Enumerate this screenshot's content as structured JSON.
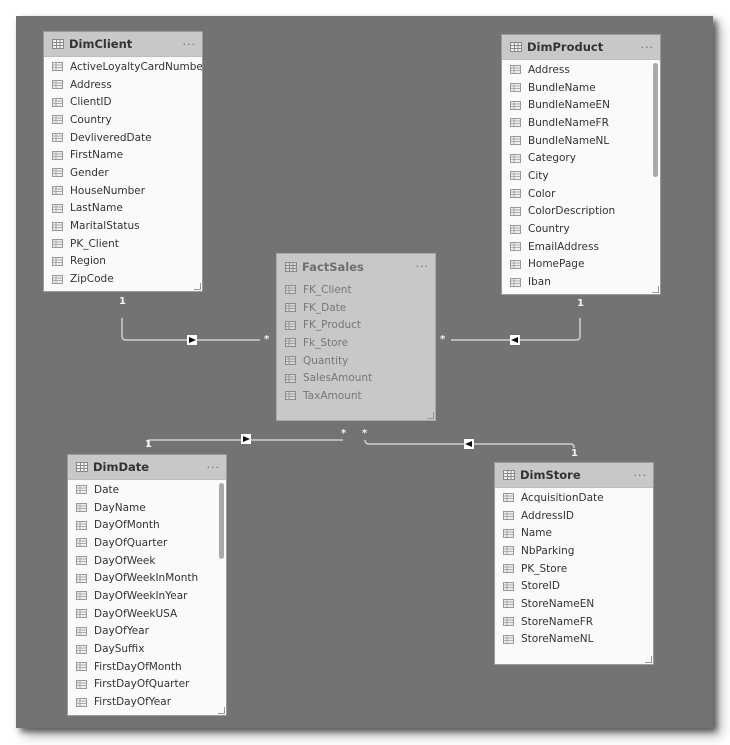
{
  "diagram": {
    "tables": {
      "dimclient": {
        "name": "DimClient",
        "more": "···",
        "columns": [
          "ActiveLoyaltyCardNumber",
          "Address",
          "ClientID",
          "Country",
          "DevliveredDate",
          "FirstName",
          "Gender",
          "HouseNumber",
          "LastName",
          "MaritalStatus",
          "PK_Client",
          "Region",
          "ZipCode"
        ]
      },
      "dimproduct": {
        "name": "DimProduct",
        "more": "···",
        "columns": [
          "Address",
          "BundleName",
          "BundleNameEN",
          "BundleNameFR",
          "BundleNameNL",
          "Category",
          "City",
          "Color",
          "ColorDescription",
          "Country",
          "EmailAddress",
          "HomePage",
          "Iban"
        ]
      },
      "factsales": {
        "name": "FactSales",
        "more": "···",
        "columns": [
          "FK_Client",
          "FK_Date",
          "FK_Product",
          "Fk_Store",
          "Quantity",
          "SalesAmount",
          "TaxAmount"
        ]
      },
      "dimdate": {
        "name": "DimDate",
        "more": "···",
        "columns": [
          "Date",
          "DayName",
          "DayOfMonth",
          "DayOfQuarter",
          "DayOfWeek",
          "DayOfWeekInMonth",
          "DayOfWeekInYear",
          "DayOfWeekUSA",
          "DayOfYear",
          "DaySuffix",
          "FirstDayOfMonth",
          "FirstDayOfQuarter",
          "FirstDayOfYear"
        ]
      },
      "dimstore": {
        "name": "DimStore",
        "more": "···",
        "columns": [
          "AcquisitionDate",
          "AddressID",
          "Name",
          "NbParking",
          "PK_Store",
          "StoreID",
          "StoreNameEN",
          "StoreNameFR",
          "StoreNameNL"
        ]
      }
    },
    "relationships": [
      {
        "from": "DimClient",
        "to": "FactSales",
        "one": "1",
        "many": "*",
        "direction": "single"
      },
      {
        "from": "DimProduct",
        "to": "FactSales",
        "one": "1",
        "many": "*",
        "direction": "single"
      },
      {
        "from": "DimDate",
        "to": "FactSales",
        "one": "1",
        "many": "*",
        "direction": "single"
      },
      {
        "from": "DimStore",
        "to": "FactSales",
        "one": "1",
        "many": "*",
        "direction": "single"
      }
    ],
    "colors": {
      "canvas": "#737373",
      "table_header": "#c8c8c8",
      "table_body": "#fafafa",
      "line": "#d0d0d0"
    }
  }
}
